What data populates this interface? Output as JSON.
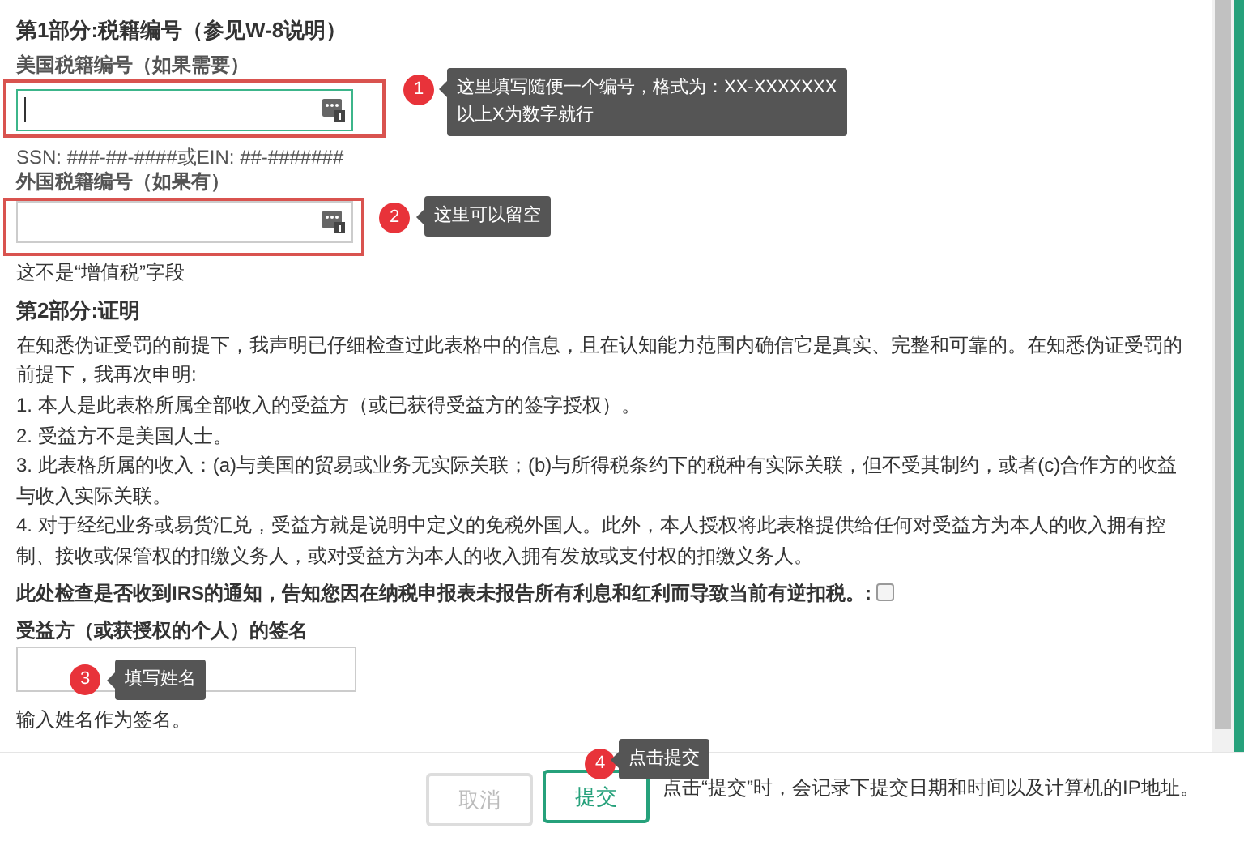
{
  "part1": {
    "title": "第1部分:税籍编号（参见W-8说明）",
    "us_tin": {
      "label": "美国税籍编号（如果需要）",
      "focused": true,
      "hint": "SSN: ###-##-####或EIN: ##-#######"
    },
    "foreign_tin": {
      "label": "外国税籍编号（如果有）",
      "focused": false,
      "note": "这不是“增值税”字段"
    }
  },
  "part2": {
    "title": "第2部分:证明",
    "paragraphs": [
      "在知悉伪证受罚的前提下，我声明已仔细检查过此表格中的信息，且在认知能力范围内确信它是真实、完整和可靠的。在知悉伪证受罚的前提下，我再次申明:",
      "1. 本人是此表格所属全部收入的受益方（或已获得受益方的签字授权）。",
      "2. 受益方不是美国人士。",
      "3. 此表格所属的收入：(a)与美国的贸易或业务无实际关联；(b)与所得税条约下的税种有实际关联，但不受其制约，或者(c)合作方的收益与收入实际关联。",
      "4. 对于经纪业务或易货汇兑，受益方就是说明中定义的免税外国人。此外，本人授权将此表格提供给任何对受益方为本人的收入拥有控制、接收或保管权的扣缴义务人，或对受益方为本人的收入拥有发放或支付权的扣缴义务人。"
    ],
    "backup_withholding": {
      "label": "此处检查是否收到IRS的通知，告知您因在纳税申报表未报告所有利息和红利而导致当前有逆扣税。:",
      "checked": false
    },
    "signature": {
      "label": "受益方（或获授权的个人）的签名",
      "note": "输入姓名作为签名。"
    }
  },
  "footer": {
    "buttons": [
      {
        "label": "取消",
        "disabled": true
      },
      {
        "label": "提交",
        "disabled": false
      }
    ],
    "note": "点击“提交”时，会记录下提交日期和时间以及计算机的IP地址。"
  },
  "annotations": [
    {
      "number": "1",
      "text": "这里填写随便一个编号，格式为：XX-XXXXXXX\n以上X为数字就行"
    },
    {
      "number": "2",
      "text": "这里可以留空"
    },
    {
      "number": "3",
      "text": "填写姓名"
    },
    {
      "number": "4",
      "text": "点击提交"
    }
  ]
}
